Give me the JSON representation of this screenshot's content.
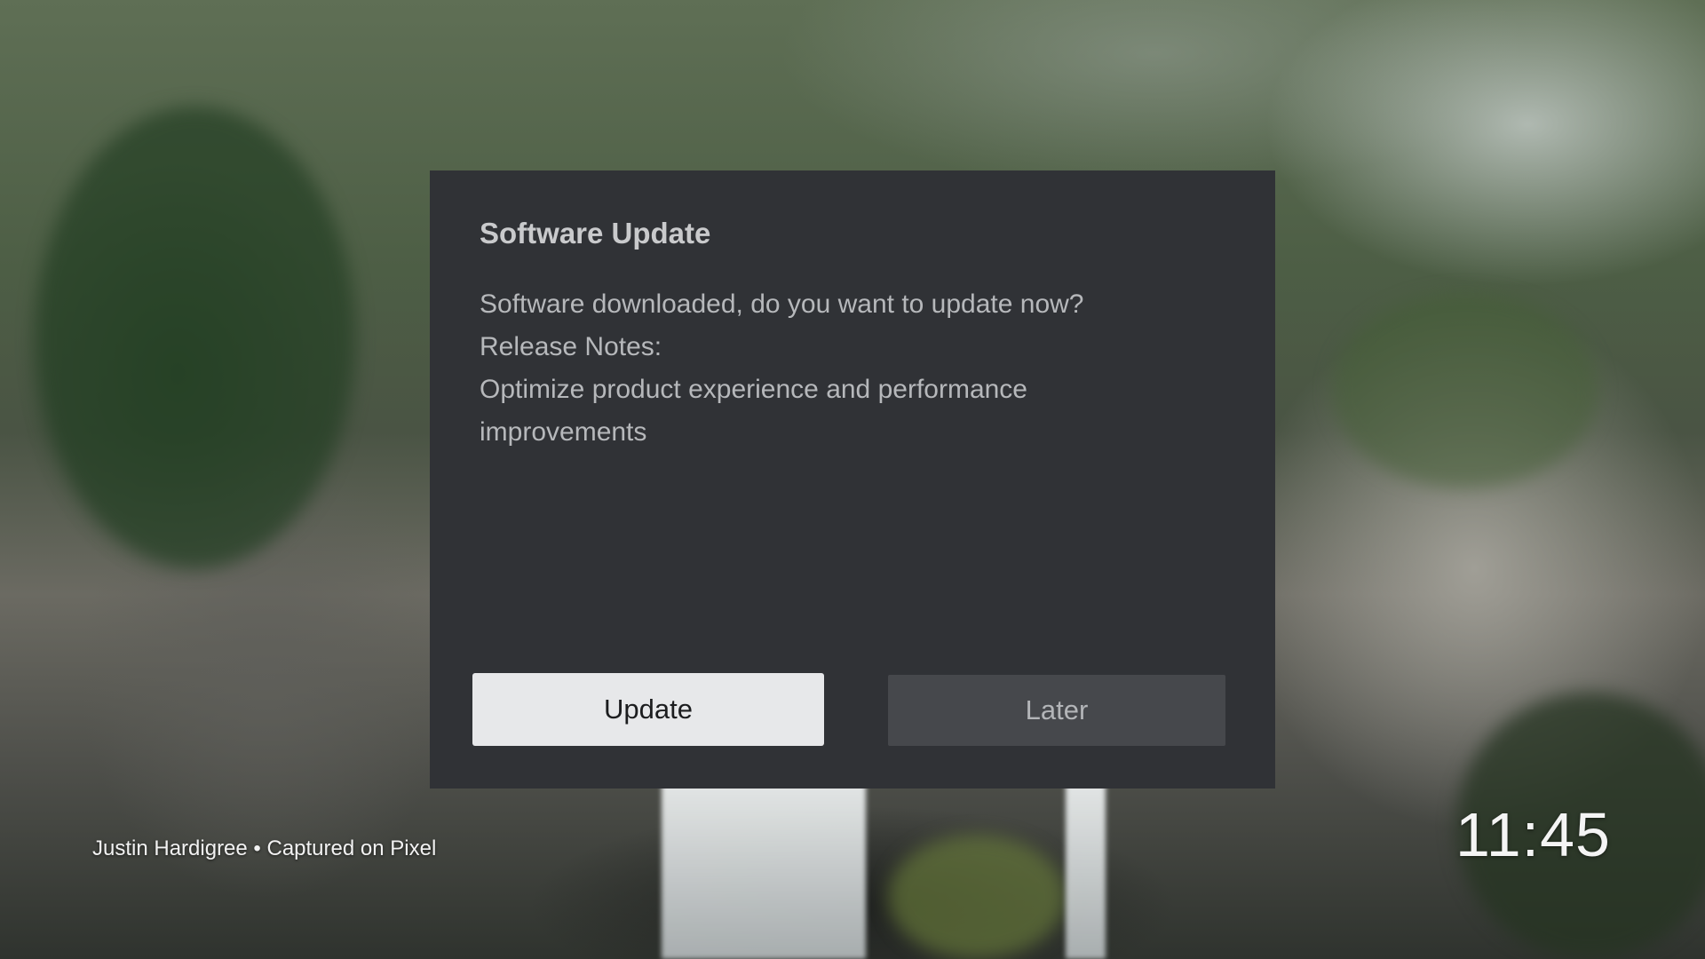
{
  "dialog": {
    "title": "Software Update",
    "message": "Software downloaded, do you want to update now?",
    "release_notes_label": "Release Notes:",
    "release_notes_text": "Optimize product experience and performance improvements",
    "update_label": "Update",
    "later_label": "Later"
  },
  "ambient": {
    "attribution": "Justin Hardigree • Captured on Pixel",
    "clock": "11:45"
  },
  "colors": {
    "dialog_background": "#303236",
    "primary_button": "#e7e8ea",
    "secondary_button": "#46484c"
  }
}
